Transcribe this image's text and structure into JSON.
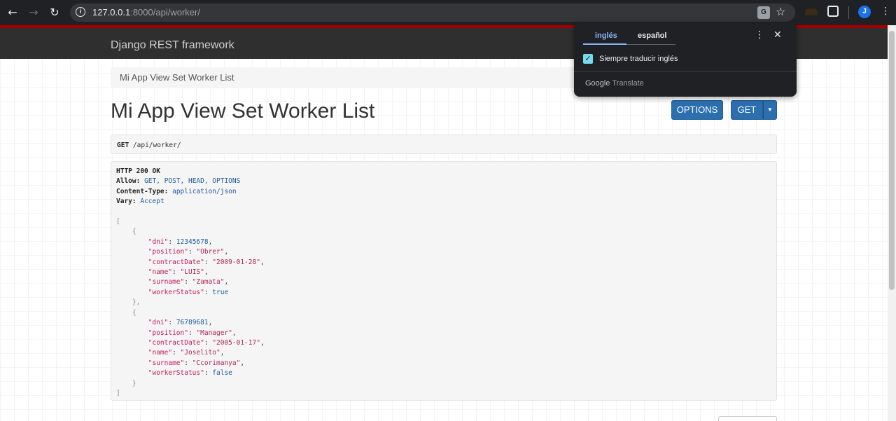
{
  "browser": {
    "url_host": "127.0.0.1",
    "url_rest": ":8000/api/worker/",
    "translate_glyph": "G",
    "star_glyph": "☆",
    "avatar_letter": "J",
    "back_glyph": "←",
    "forward_glyph": "→",
    "reload_glyph": "↻",
    "menu_glyph": "⋮"
  },
  "navbar": {
    "brand": "Django REST framework"
  },
  "breadcrumb": {
    "label": "Mi App View Set Worker List"
  },
  "page": {
    "title": "Mi App View Set Worker List",
    "options_label": "OPTIONS",
    "get_label": "GET",
    "caret_glyph": "▼"
  },
  "request": {
    "method": "GET",
    "path": "/api/worker/"
  },
  "response": {
    "status": "HTTP 200 OK",
    "allow_key": "Allow:",
    "allow_val": "GET, POST, HEAD, OPTIONS",
    "ctype_key": "Content-Type:",
    "ctype_val": "application/json",
    "vary_key": "Vary:",
    "vary_val": "Accept",
    "workers": [
      {
        "dni": "12345678",
        "position": "\"Obrer\"",
        "contractDate": "\"2009-01-28\"",
        "name": "\"LUIS\"",
        "surname": "\"Zamata\"",
        "workerStatus": "true"
      },
      {
        "dni": "76789681",
        "position": "\"Manager\"",
        "contractDate": "\"2005-01-17\"",
        "name": "\"Joselito\"",
        "surname": "\"Ccorimanya\"",
        "workerStatus": "false"
      }
    ]
  },
  "translate": {
    "tab_source": "inglés",
    "tab_target": "español",
    "always_translate": "Siempre traducir inglés",
    "always_translate_checked": true,
    "google": "Google",
    "translate_word": "Translate",
    "menu_glyph": "⋮",
    "close_glyph": "✕",
    "check_glyph": "✓"
  }
}
